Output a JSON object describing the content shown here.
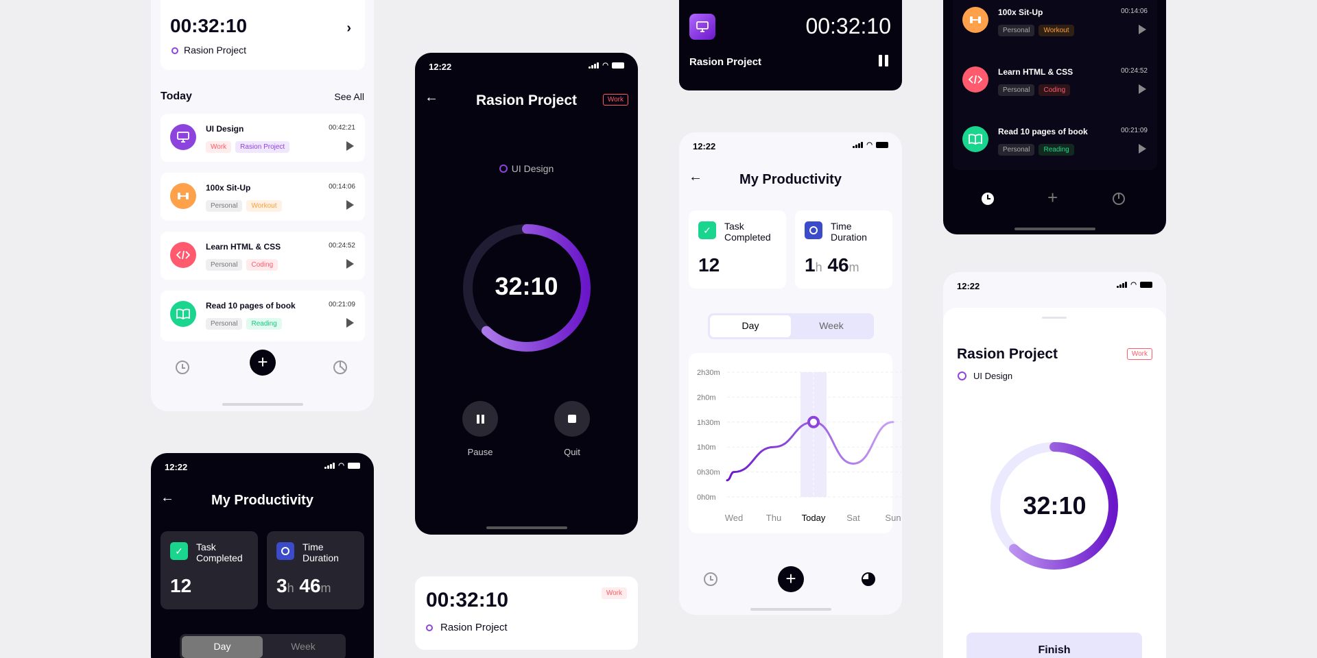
{
  "status_time": "12:22",
  "card_top_left": {
    "timer": "00:32:10",
    "project": "Rasion Project",
    "today_label": "Today",
    "see_all": "See All",
    "tasks": [
      {
        "name": "UI Design",
        "time": "00:42:21",
        "tags": [
          "Work",
          "Rasion Project"
        ]
      },
      {
        "name": "100x Sit-Up",
        "time": "00:14:06",
        "tags": [
          "Personal",
          "Workout"
        ]
      },
      {
        "name": "Learn HTML & CSS",
        "time": "00:24:52",
        "tags": [
          "Personal",
          "Coding"
        ]
      },
      {
        "name": "Read 10 pages of book",
        "time": "00:21:09",
        "tags": [
          "Personal",
          "Reading"
        ]
      }
    ]
  },
  "timer_dark": {
    "title": "Rasion Project",
    "tag": "Work",
    "task": "UI Design",
    "time": "32:10",
    "progress": 0.62,
    "pause_label": "Pause",
    "quit_label": "Quit"
  },
  "widget_bottom": {
    "timer": "00:32:10",
    "project": "Rasion Project",
    "tag": "Work"
  },
  "widget_dark_top": {
    "timer": "00:32:10",
    "project": "Rasion Project"
  },
  "productivity_light": {
    "title": "My Productivity",
    "task_completed_label": "Task Completed",
    "task_completed_value": "12",
    "time_duration_label": "Time Duration",
    "hours": "1",
    "hours_unit": "h",
    "minutes": "46",
    "minutes_unit": "m",
    "seg_day": "Day",
    "seg_week": "Week",
    "chart_data": {
      "type": "line",
      "categories": [
        "Wed",
        "Thu",
        "Today",
        "Sat",
        "Sun"
      ],
      "yticks": [
        "2h30m",
        "2h0m",
        "1h30m",
        "1h0m",
        "0h30m",
        "0h0m"
      ],
      "values_minutes": [
        30,
        60,
        90,
        40,
        90
      ],
      "highlight": "Today",
      "ylim": [
        0,
        150
      ]
    }
  },
  "productivity_dark": {
    "title": "My Productivity",
    "task_completed_label": "Task Completed",
    "task_completed_value": "12",
    "time_duration_label": "Time Duration",
    "hours": "3",
    "hours_unit": "h",
    "minutes": "46",
    "minutes_unit": "m",
    "seg_day": "Day",
    "seg_week": "Week"
  },
  "list_dark": {
    "tasks": [
      {
        "name": "100x Sit-Up",
        "time": "00:14:06",
        "tags": [
          "Personal",
          "Workout"
        ]
      },
      {
        "name": "Learn HTML & CSS",
        "time": "00:24:52",
        "tags": [
          "Personal",
          "Coding"
        ]
      },
      {
        "name": "Read 10 pages of book",
        "time": "00:21:09",
        "tags": [
          "Personal",
          "Reading"
        ]
      }
    ]
  },
  "timer_light": {
    "title": "Rasion Project",
    "tag": "Work",
    "task": "UI Design",
    "time": "32:10",
    "progress": 0.62,
    "finish_label": "Finish"
  },
  "colors": {
    "accent": "#8d44dd",
    "accent_dark": "#6a17c9",
    "green": "#19d58d",
    "orange": "#ffa04a",
    "red": "#ff5a6e",
    "blue": "#3b4bc9"
  }
}
